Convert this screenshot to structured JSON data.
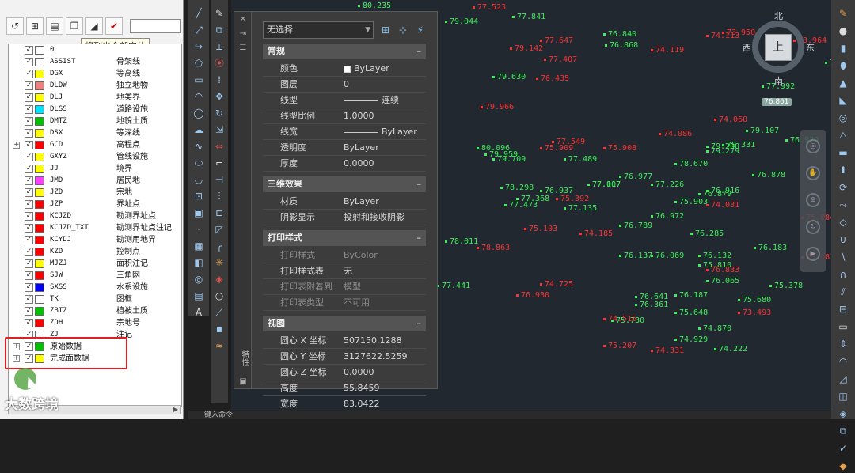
{
  "layer_panel": {
    "tooltip": "将列出全部实体",
    "toolbar_icons": [
      "layer-c-icon",
      "layer-filter-icon",
      "layer-window-icon",
      "layer-copy-icon",
      "layer-fill-icon",
      "check-all-icon"
    ],
    "layers": [
      {
        "name": "0",
        "desc": "",
        "color": "#ffffff"
      },
      {
        "name": "ASSIST",
        "desc": "骨架线",
        "color": "#ffffff"
      },
      {
        "name": "DGX",
        "desc": "等高线",
        "color": "#ffff00"
      },
      {
        "name": "DLDW",
        "desc": "独立地物",
        "color": "#f08080"
      },
      {
        "name": "DLJ",
        "desc": "地类界",
        "color": "#ffff00"
      },
      {
        "name": "DLSS",
        "desc": "道路设施",
        "color": "#00e0ff"
      },
      {
        "name": "DMTZ",
        "desc": "地貌土质",
        "color": "#00c000"
      },
      {
        "name": "DSX",
        "desc": "等深线",
        "color": "#ffff00"
      },
      {
        "name": "GCD",
        "desc": "高程点",
        "color": "#ff0000",
        "expander": true
      },
      {
        "name": "GXYZ",
        "desc": "管线设施",
        "color": "#ffff00"
      },
      {
        "name": "JJ",
        "desc": "境界",
        "color": "#ffff00"
      },
      {
        "name": "JMD",
        "desc": "居民地",
        "color": "#ff40ff"
      },
      {
        "name": "JZD",
        "desc": "宗地",
        "color": "#ffff00"
      },
      {
        "name": "JZP",
        "desc": "界址点",
        "color": "#ff0000"
      },
      {
        "name": "KCJZD",
        "desc": "勘测界址点",
        "color": "#ff0000"
      },
      {
        "name": "KCJZD_TXT",
        "desc": "勘测界址点注记",
        "color": "#ff0000"
      },
      {
        "name": "KCYDJ",
        "desc": "勘测用地界",
        "color": "#ff0000"
      },
      {
        "name": "KZD",
        "desc": "控制点",
        "color": "#ff0000"
      },
      {
        "name": "MJZJ",
        "desc": "面积注记",
        "color": "#ffff00"
      },
      {
        "name": "SJW",
        "desc": "三角网",
        "color": "#ff0000"
      },
      {
        "name": "SXSS",
        "desc": "水系设施",
        "color": "#0000ff"
      },
      {
        "name": "TK",
        "desc": "图框",
        "color": "#ffffff"
      },
      {
        "name": "ZBTZ",
        "desc": "植被土质",
        "color": "#00c000"
      },
      {
        "name": "ZDH",
        "desc": "宗地号",
        "color": "#ff0000"
      },
      {
        "name": "ZJ",
        "desc": "注记",
        "color": "#ffffff"
      }
    ],
    "groups": [
      {
        "name": "原始数据",
        "color": "#00c000"
      },
      {
        "name": "完成面数据",
        "color": "#ffff00"
      }
    ],
    "watermark": "大数跨境"
  },
  "properties": {
    "selection": "无选择",
    "sections": {
      "general": "常规",
      "threed": "三维效果",
      "plot": "打印样式",
      "view": "视图"
    },
    "general_rows": [
      {
        "label": "颜色",
        "value": "ByLayer",
        "kind": "color"
      },
      {
        "label": "图层",
        "value": "0"
      },
      {
        "label": "线型",
        "value": "连续",
        "kind": "line"
      },
      {
        "label": "线型比例",
        "value": "1.0000"
      },
      {
        "label": "线宽",
        "value": "ByLayer",
        "kind": "line"
      },
      {
        "label": "透明度",
        "value": "ByLayer"
      },
      {
        "label": "厚度",
        "value": "0.0000"
      }
    ],
    "threed_rows": [
      {
        "label": "材质",
        "value": "ByLayer"
      },
      {
        "label": "阴影显示",
        "value": "投射和接收阴影"
      }
    ],
    "plot_rows": [
      {
        "label": "打印样式",
        "value": "ByColor",
        "dim": true
      },
      {
        "label": "打印样式表",
        "value": "无"
      },
      {
        "label": "打印表附着到",
        "value": "模型",
        "dim": true
      },
      {
        "label": "打印表类型",
        "value": "不可用",
        "dim": true
      }
    ],
    "view_rows": [
      {
        "label": "圆心 X 坐标",
        "value": "507150.1288"
      },
      {
        "label": "圆心 Y 坐标",
        "value": "3127622.5259"
      },
      {
        "label": "圆心 Z 坐标",
        "value": "0.0000"
      },
      {
        "label": "高度",
        "value": "55.8459"
      },
      {
        "label": "宽度",
        "value": "83.0422"
      }
    ],
    "side_title": "特性"
  },
  "viewcube": {
    "top": "上",
    "north": "北",
    "south": "南",
    "east": "东",
    "west": "西"
  },
  "coord_badge": "76.861",
  "points_green": [
    "80.235",
    "79.044",
    "77.841",
    "76.840",
    "76.868",
    "79.630",
    "80.096",
    "79.959",
    "79.709",
    "78.298",
    "77.368",
    "77.473",
    "76.937",
    "76.977",
    "77.007",
    "77.226",
    "76.878",
    "76.916",
    "78.670",
    "79.279",
    "79.107",
    "79.331",
    "76.929",
    "79.200",
    "77.992",
    "76.751",
    "75.680",
    "75.378",
    "76.285",
    "76.183",
    "76.132",
    "75.810",
    "76.069",
    "76.137",
    "76.361",
    "76.641",
    "76.187",
    "75.648",
    "74.929",
    "74.222",
    "77.441",
    "78.011",
    "77.135",
    "76.972",
    "77.117",
    "75.903",
    "75.730",
    "76.065",
    "74.870",
    "76.879",
    "76.789",
    "77.489"
  ],
  "points_red": [
    "77.523",
    "77.647",
    "77.407",
    "79.142",
    "76.435",
    "79.966",
    "77.549",
    "75.909",
    "75.908",
    "74.086",
    "74.119",
    "75.392",
    "75.103",
    "74.185",
    "78.863",
    "74.725",
    "76.930",
    "74.516",
    "75.207",
    "74.331",
    "73.493",
    "76.833",
    "74.031",
    "74.060",
    "74.113",
    "73.950",
    "73.964",
    "75.884",
    "75.281"
  ],
  "bottom_strip": "键入命令"
}
